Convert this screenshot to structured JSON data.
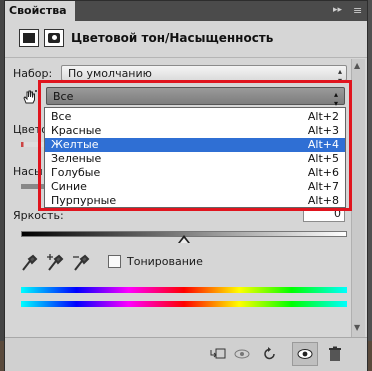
{
  "panel": {
    "tab_label": "Свойства",
    "collapse_glyph": "▸▸",
    "menu_glyph": "≡"
  },
  "header": {
    "title": "Цветовой тон/Насыщенность"
  },
  "preset": {
    "label": "Набор:",
    "value": "По умолчанию"
  },
  "channel": {
    "value": "Все",
    "options": [
      {
        "label": "Все",
        "shortcut": "Alt+2"
      },
      {
        "label": "Красные",
        "shortcut": "Alt+3"
      },
      {
        "label": "Желтые",
        "shortcut": "Alt+4"
      },
      {
        "label": "Зеленые",
        "shortcut": "Alt+5"
      },
      {
        "label": "Голубые",
        "shortcut": "Alt+6"
      },
      {
        "label": "Синие",
        "shortcut": "Alt+7"
      },
      {
        "label": "Пурпурные",
        "shortcut": "Alt+8"
      }
    ],
    "selected_index": 2
  },
  "sliders": {
    "hue_label_partial": "Цвето",
    "saturation_label_partial": "Насы",
    "brightness_label": "Яркость:",
    "brightness_value": "0"
  },
  "colorize": {
    "label": "Тонирование",
    "checked": false
  },
  "icons": {
    "hand": "hand-tool-icon",
    "eyedropper": "eyedropper-icon",
    "eyedropper_plus": "eyedropper-add-icon",
    "eyedropper_minus": "eyedropper-subtract-icon",
    "clip": "clip-to-layer-icon",
    "view_prev": "view-previous-icon",
    "reset": "reset-icon",
    "visibility": "eye-icon",
    "trash": "trash-icon"
  },
  "colors": {
    "highlight": "#2f6fd4",
    "red_outline": "#e0141e"
  }
}
